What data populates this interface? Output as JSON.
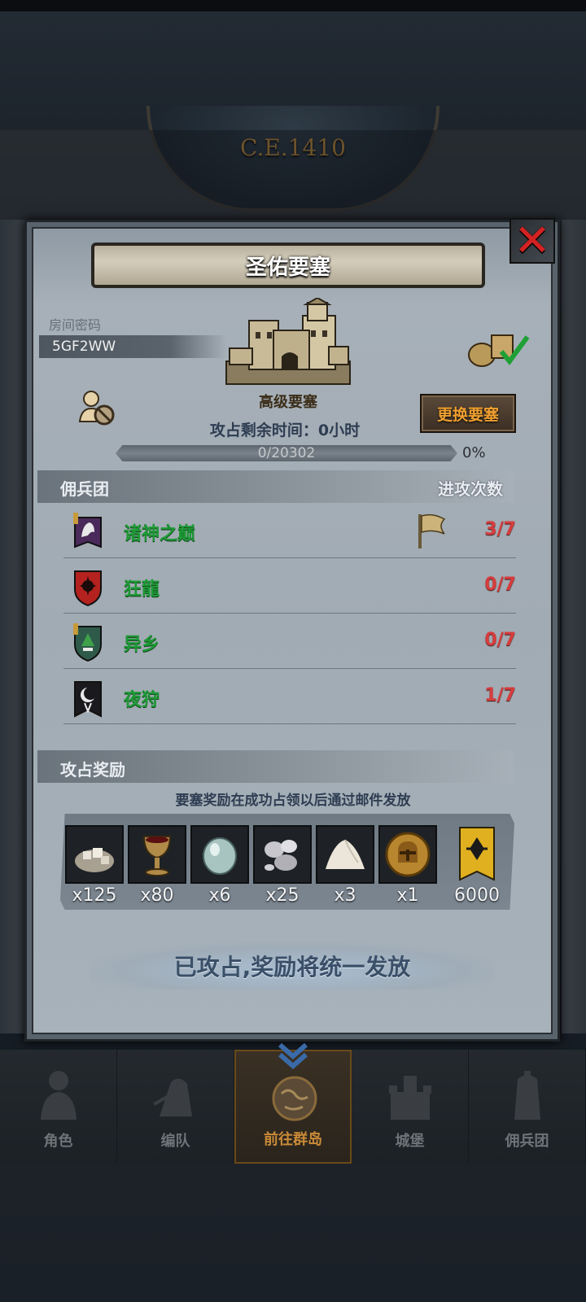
{
  "background": {
    "era": "C.E.1410"
  },
  "dialog": {
    "title": "圣佑要塞",
    "close_icon": "close-x-icon",
    "room_password_label": "房间密码",
    "room_password_value": "5GF2WW",
    "fortress_type": "高级要塞",
    "change_fortress_label": "更换要塞",
    "time_remaining": "攻占剩余时间：0小时",
    "progress": {
      "text": "0/20302",
      "percent_label": "0%",
      "fraction": 0
    }
  },
  "mercenaries": {
    "header_left": "佣兵团",
    "header_right": "进攻次数",
    "rows": [
      {
        "name": "诸神之巅",
        "attacks": "3/7",
        "icon": "wolf-banner-icon",
        "flag": "flag-icon"
      },
      {
        "name": "狂龍",
        "attacks": "0/7",
        "icon": "red-shield-icon"
      },
      {
        "name": "异乡",
        "attacks": "0/7",
        "icon": "tree-shield-icon"
      },
      {
        "name": "夜狩",
        "attacks": "1/7",
        "icon": "moon-banner-icon"
      }
    ]
  },
  "rewards": {
    "header": "攻占奖励",
    "note": "要塞奖励在成功占领以后通过邮件发放",
    "items": [
      {
        "icon": "stone-pile-icon",
        "qty": "x125"
      },
      {
        "icon": "goblet-icon",
        "qty": "x80"
      },
      {
        "icon": "gem-icon",
        "qty": "x6"
      },
      {
        "icon": "silver-ore-icon",
        "qty": "x25"
      },
      {
        "icon": "salt-pile-icon",
        "qty": "x3"
      },
      {
        "icon": "helmet-coin-icon",
        "qty": "x1"
      },
      {
        "icon": "guild-banner-icon",
        "qty": "6000"
      }
    ]
  },
  "status_message": "已攻占,奖励将统一发放",
  "bottom_nav": {
    "items": [
      {
        "label": "角色",
        "icon": "knight-icon"
      },
      {
        "label": "编队",
        "icon": "formation-icon"
      },
      {
        "label": "前往群岛",
        "icon": "globe-icon",
        "active": true
      },
      {
        "label": "城堡",
        "icon": "castle-icon"
      },
      {
        "label": "佣兵团",
        "icon": "mercenary-icon"
      }
    ]
  },
  "colors": {
    "accent_orange": "#f0a030",
    "merc_green": "#1e9a36",
    "count_red": "#d63d3d",
    "close_red": "#d42222"
  }
}
